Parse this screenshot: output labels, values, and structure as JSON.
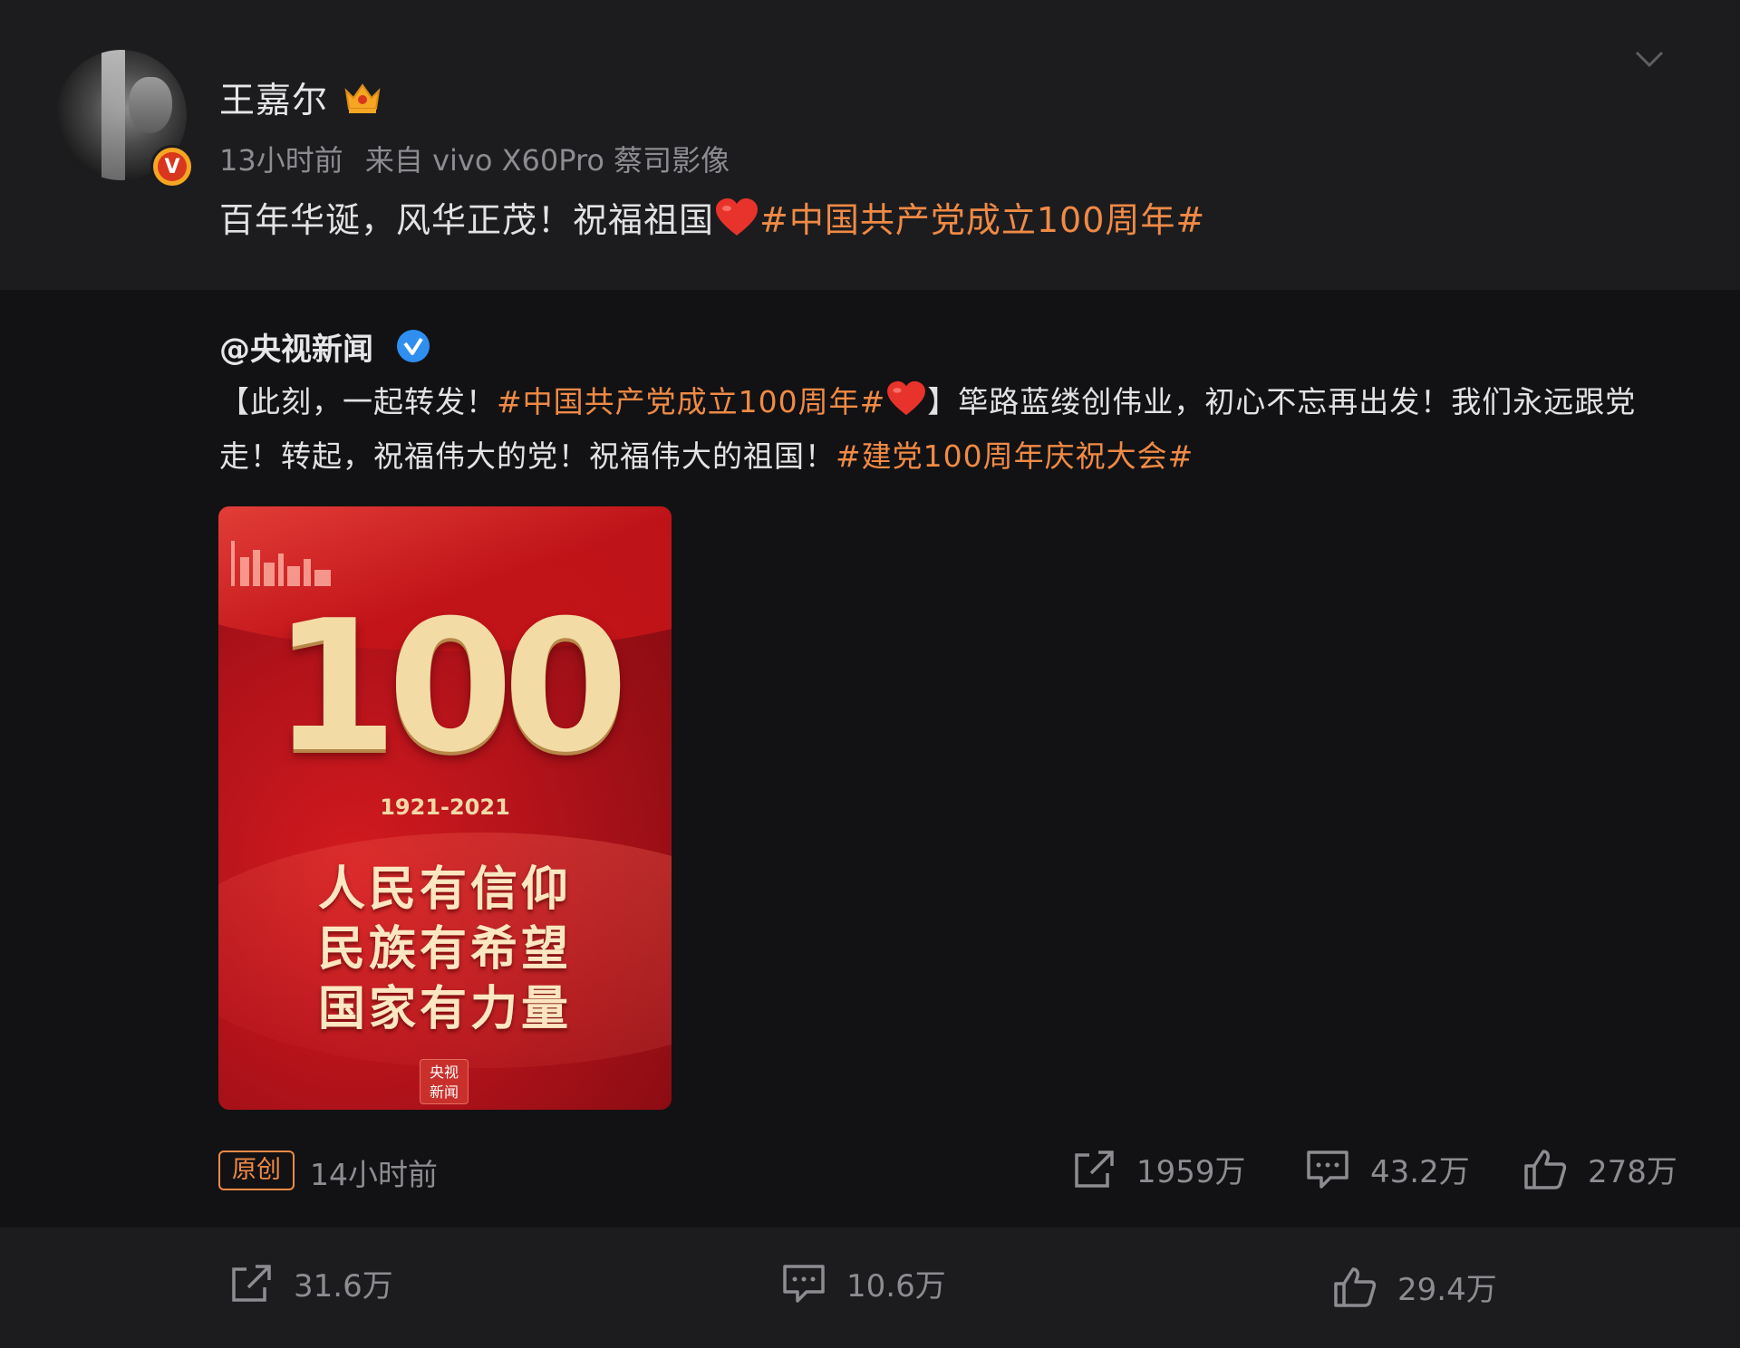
{
  "post": {
    "username": "王嘉尔",
    "time": "13小时前",
    "source": "来自 vivo X60Pro 蔡司影像",
    "text_prefix": "百年华诞，风华正茂！祝福祖国",
    "text_topic": "#中国共产党成立100周年#"
  },
  "repost": {
    "username": "@央视新闻",
    "text_part1": "【此刻，一起转发！",
    "topic1": "#中国共产党成立100周年#",
    "text_part2": "】筚路蓝缕创伟业，初心不忘再出发！我们永远跟党走！转起，祝福伟大的党！祝福伟大的祖国！",
    "topic2": "#建党100周年庆祝大会#",
    "image": {
      "number": "100",
      "years": "1921-2021",
      "slogan_lines": [
        "人民有信仰",
        "民族有希望",
        "国家有力量"
      ],
      "logo_text": "央视新闻"
    },
    "original_badge": "原创",
    "time": "14小时前",
    "stats": {
      "share": "1959万",
      "comment": "43.2万",
      "like": "278万"
    }
  },
  "bottom_stats": {
    "share": "31.6万",
    "comment": "10.6万",
    "like": "29.4万"
  },
  "colors": {
    "topic": "#f08a45",
    "background": "#17171a",
    "card": "#1c1c1f",
    "repost_bg": "#121214"
  }
}
